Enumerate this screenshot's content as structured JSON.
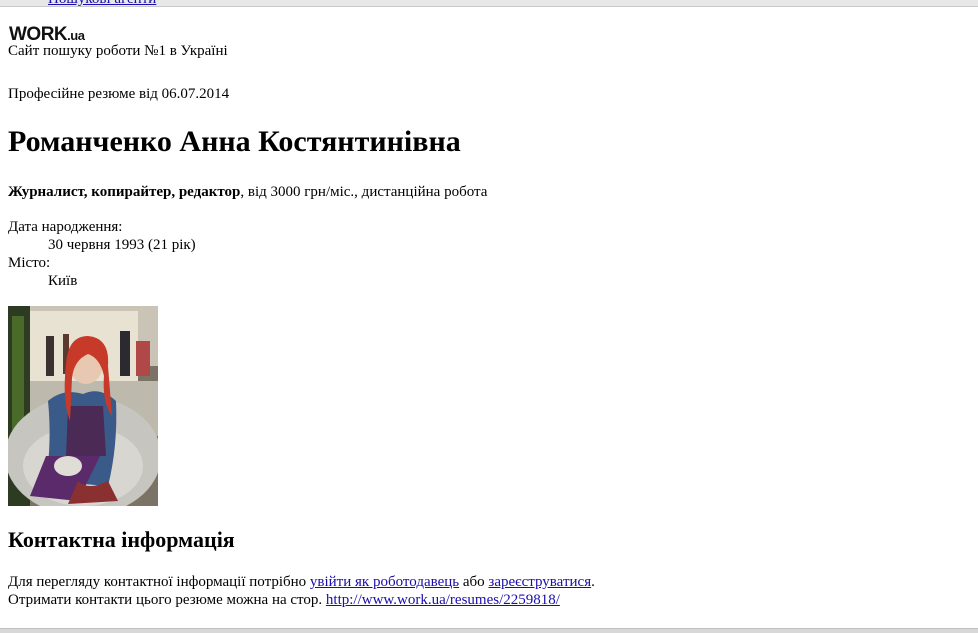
{
  "header": {
    "cutoff_link": "Пошукові агенти",
    "logo_main": "WORK",
    "logo_suffix": ".ua",
    "tagline": "Сайт пошуку роботи №1 в Україні"
  },
  "resume": {
    "date_line": "Професійне резюме від 06.07.2014",
    "full_name": "Романченко Анна Костянтинівна",
    "position": "Журналист, копирайтер, редактор",
    "position_details": ", від 3000 грн/міс., дистанційна робота",
    "details": [
      {
        "term": "Дата народження:",
        "value": "30 червня 1993 (21 рік)"
      },
      {
        "term": "Місто:",
        "value": "Київ"
      }
    ]
  },
  "contact": {
    "heading": "Контактна інформація",
    "line1_prefix": "Для перегляду контактної інформації потрібно ",
    "login_link": "увійти як роботодавець",
    "line1_middle": " або ",
    "register_link": "зареєструватися",
    "line1_suffix": ".",
    "line2_prefix": "Отримати контакти цього резюме можна на стор. ",
    "resume_url": "http://www.work.ua/resumes/2259818/"
  },
  "colors": {
    "link": "#1a0dab",
    "text": "#000000",
    "background": "#ffffff"
  }
}
